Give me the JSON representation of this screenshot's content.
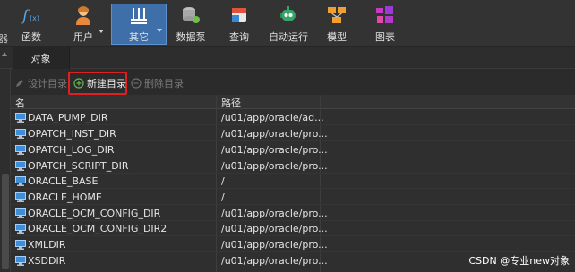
{
  "toolbar": {
    "left_fragment": "器",
    "buttons": [
      {
        "label": "函数",
        "icon": "function-icon"
      },
      {
        "label": "用户",
        "icon": "user-icon"
      },
      {
        "label": "其它",
        "icon": "tools-icon"
      },
      {
        "label": "数据泵",
        "icon": "data-pump-icon"
      },
      {
        "label": "查询",
        "icon": "query-icon"
      },
      {
        "label": "自动运行",
        "icon": "robot-icon"
      },
      {
        "label": "模型",
        "icon": "model-icon"
      },
      {
        "label": "图表",
        "icon": "chart-icon"
      }
    ]
  },
  "tabs": {
    "object": "对象"
  },
  "subbar": {
    "design": "设计目录",
    "new": "新建目录",
    "delete": "删除目录"
  },
  "table": {
    "headers": {
      "name": "名",
      "path": "路径"
    },
    "rows": [
      {
        "name": "DATA_PUMP_DIR",
        "path": "/u01/app/oracle/ad..."
      },
      {
        "name": "OPATCH_INST_DIR",
        "path": "/u01/app/oracle/pro..."
      },
      {
        "name": "OPATCH_LOG_DIR",
        "path": "/u01/app/oracle/pro..."
      },
      {
        "name": "OPATCH_SCRIPT_DIR",
        "path": "/u01/app/oracle/pro..."
      },
      {
        "name": "ORACLE_BASE",
        "path": "/"
      },
      {
        "name": "ORACLE_HOME",
        "path": "/"
      },
      {
        "name": "ORACLE_OCM_CONFIG_DIR",
        "path": "/u01/app/oracle/pro..."
      },
      {
        "name": "ORACLE_OCM_CONFIG_DIR2",
        "path": "/u01/app/oracle/pro..."
      },
      {
        "name": "XMLDIR",
        "path": "/u01/app/oracle/pro..."
      },
      {
        "name": "XSDDIR",
        "path": "/u01/app/oracle/pro..."
      }
    ]
  },
  "watermark": "CSDN @专业new对象",
  "colors": {
    "active": "#3f6fa8",
    "highlight": "#e02020",
    "background": "#2b2b2b"
  }
}
